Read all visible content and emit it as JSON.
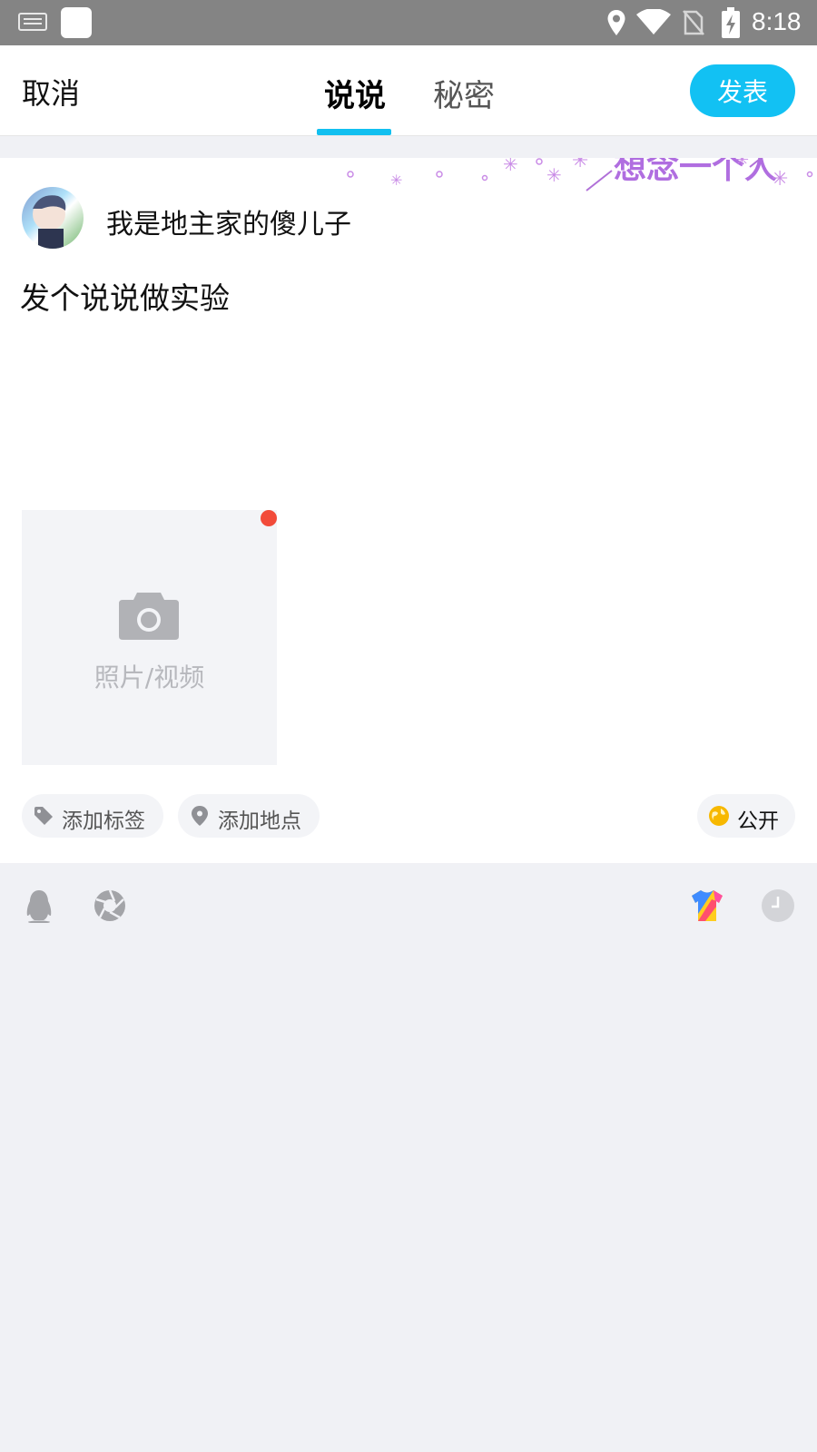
{
  "status_bar": {
    "time": "8:18",
    "icons": [
      "keyboard-icon",
      "app-icon",
      "location-icon",
      "wifi-icon",
      "no-sim-icon",
      "battery-charging-icon"
    ]
  },
  "header": {
    "cancel_label": "取消",
    "tabs": [
      {
        "label": "说说",
        "active": true
      },
      {
        "label": "秘密",
        "active": false
      }
    ],
    "publish_label": "发表",
    "accent_color": "#12c1f3"
  },
  "compose": {
    "decoration_text": "想念一个人",
    "username": "我是地主家的傻儿子",
    "post_text": "发个说说做实验",
    "media_placeholder": "照片/视频",
    "tag_chip": "添加标签",
    "location_chip": "添加地点",
    "visibility_chip": "公开"
  },
  "toolbar": {
    "icons": [
      "qq-penguin-icon",
      "camera-aperture-icon",
      "theme-shirt-icon",
      "clock-icon"
    ]
  }
}
